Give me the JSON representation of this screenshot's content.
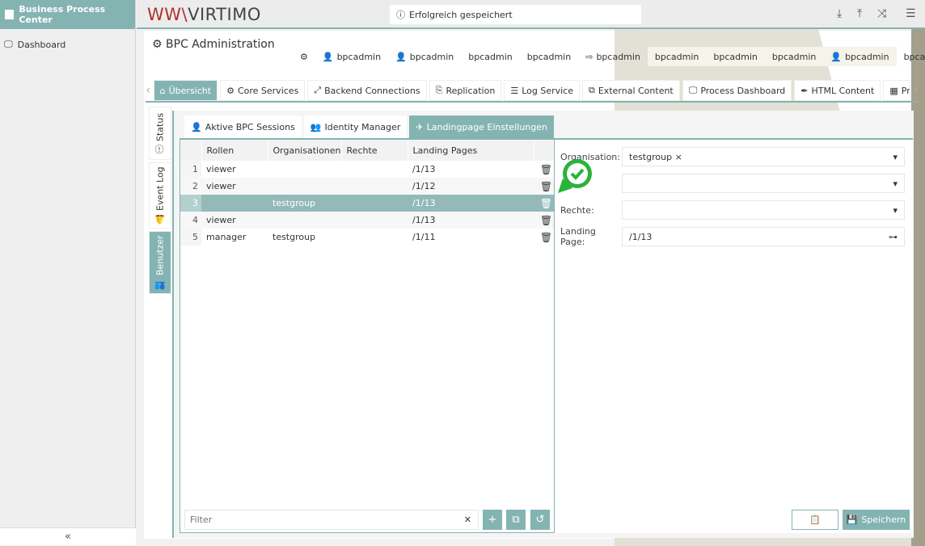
{
  "app": {
    "title": "Business Process Center",
    "brand": "VIRTIMO",
    "brand_mark": "WW\\"
  },
  "sidebar": {
    "items": [
      {
        "label": "Dashboard",
        "icon": "monitor-icon"
      }
    ],
    "collapse": "«"
  },
  "notification": {
    "text": "Erfolgreich gespeichert",
    "icon": "info-icon"
  },
  "header": {
    "title": "BPC Administration",
    "users": [
      "bpcadmin",
      "bpcadmin",
      "bpcadmin",
      "bpcadmin",
      "bpcadmin",
      "bpcadmin",
      "bpcadmin",
      "bpcadmin",
      "bpcadmin",
      "bpcadmin"
    ]
  },
  "tabs": [
    {
      "label": "Übersicht",
      "icon": "⌂"
    },
    {
      "label": "Core Services",
      "icon": "⚙"
    },
    {
      "label": "Backend Connections",
      "icon": "⤢"
    },
    {
      "label": "Replication",
      "icon": "⎘"
    },
    {
      "label": "Log Service",
      "icon": "☰"
    },
    {
      "label": "External Content",
      "icon": "⧉"
    },
    {
      "label": "Process Dashboard",
      "icon": "🖵"
    },
    {
      "label": "HTML Content",
      "icon": "✒"
    },
    {
      "label": "Proce",
      "icon": "▦"
    }
  ],
  "vtabs": [
    {
      "label": "Status",
      "icon": "ⓘ"
    },
    {
      "label": "Event Log",
      "icon": "🔔"
    },
    {
      "label": "Benutzer",
      "icon": "👥"
    }
  ],
  "subtabs": [
    {
      "label": "Aktive BPC Sessions",
      "icon": "👤"
    },
    {
      "label": "Identity Manager",
      "icon": "👥"
    },
    {
      "label": "Landingpage Einstellungen",
      "icon": "✈"
    }
  ],
  "grid": {
    "columns": [
      "Rollen",
      "Organisationen",
      "Rechte",
      "Landing Pages"
    ],
    "rows": [
      {
        "n": "1",
        "rolle": "viewer",
        "org": "",
        "rechte": "",
        "page": "/1/13"
      },
      {
        "n": "2",
        "rolle": "viewer",
        "org": "",
        "rechte": "",
        "page": "/1/12"
      },
      {
        "n": "3",
        "rolle": "",
        "org": "testgroup",
        "rechte": "",
        "page": "/1/13",
        "selected": true
      },
      {
        "n": "4",
        "rolle": "viewer",
        "org": "",
        "rechte": "",
        "page": "/1/13"
      },
      {
        "n": "5",
        "rolle": "manager",
        "org": "testgroup",
        "rechte": "",
        "page": "/1/11"
      }
    ],
    "filter_placeholder": "Filter"
  },
  "form": {
    "org_label": "Organisation:",
    "org_value": "testgroup",
    "rechte_label": "Rechte:",
    "landing_label": "Landing Page:",
    "landing_value": "/1/13"
  },
  "buttons": {
    "save": "Speichern"
  },
  "colors": {
    "accent": "#84b4b2",
    "success": "#2bb33a"
  }
}
